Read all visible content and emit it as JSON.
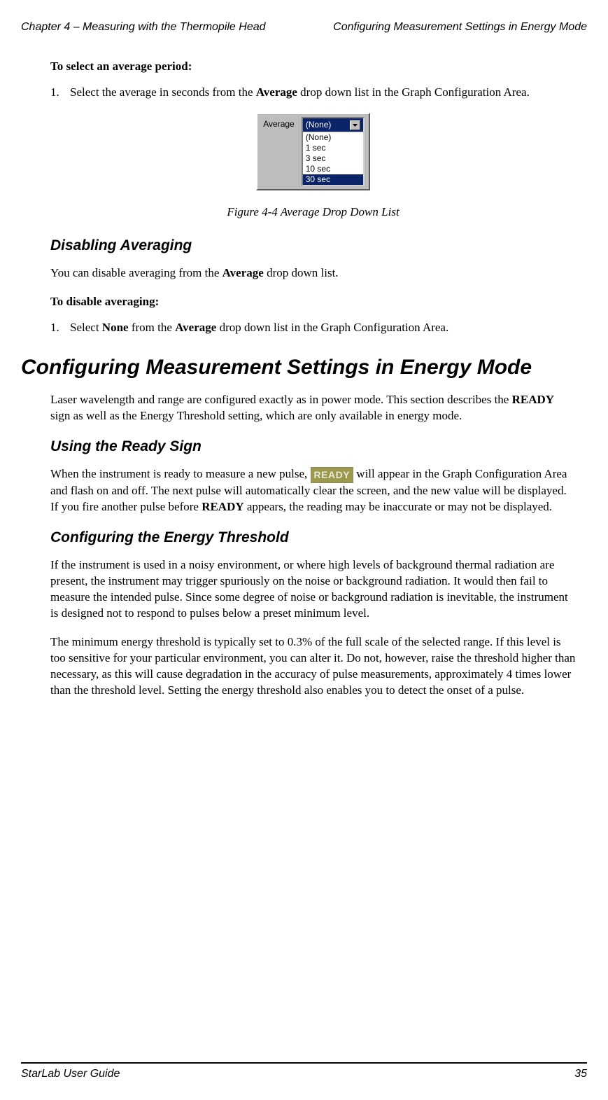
{
  "running_head": {
    "left": "Chapter 4 – Measuring with the Thermopile Head",
    "right": "Configuring Measurement Settings in Energy Mode"
  },
  "intro1": "To select an average period:",
  "step1": {
    "num": "1.",
    "pre": "Select the average in seconds from the ",
    "bold": "Average",
    "post": " drop down list in the Graph Configuration Area."
  },
  "dropdown": {
    "label": "Average",
    "selected": "(None)",
    "items": [
      "(None)",
      "1 sec",
      "3 sec",
      "10 sec",
      "30 sec"
    ],
    "highlight_index": 4
  },
  "fig_caption": "Figure 4-4 Average Drop Down List",
  "sub1": "Disabling Averaging",
  "para1": {
    "pre": "You can disable averaging from the ",
    "bold": "Average",
    "post": " drop down list."
  },
  "intro2": "To disable averaging:",
  "step2": {
    "num": "1.",
    "a": "Select ",
    "b1": "None",
    "b": " from the ",
    "b2": "Average",
    "c": " drop down list in the Graph Configuration Area."
  },
  "big_h": "Configuring Measurement Settings in Energy Mode",
  "para2": {
    "a": "Laser wavelength and range are configured exactly as in power mode. This section describes the ",
    "b": "READY",
    "c": " sign as well as the Energy Threshold setting, which are only available in energy mode."
  },
  "sub2": "Using the Ready Sign",
  "ready_label": "READY",
  "para3": {
    "a": "When the instrument is ready to measure a new pulse, ",
    "b": " will appear in the Graph Configuration Area and flash on and off. The next pulse will automatically clear the screen, and the new value will be displayed. If you fire another pulse before ",
    "c": "READY",
    "d": " appears, the reading may be inaccurate or may not be displayed."
  },
  "sub3": "Configuring the Energy Threshold",
  "para4": "If the instrument is used in a noisy environment, or where high levels of background thermal radiation are present, the instrument may trigger spuriously on the noise or background radiation. It would then fail to measure the intended pulse. Since some degree of noise or background radiation is inevitable, the instrument is designed not to respond to pulses below a preset minimum level.",
  "para5": "The minimum energy threshold is typically set to 0.3% of the full scale of the selected range. If this level is too sensitive for your particular environment, you can alter it. Do not, however, raise the threshold higher than necessary, as this will cause degradation in the accuracy of pulse measurements, approximately 4 times lower than the threshold level. Setting the energy threshold also enables you to detect the onset of a pulse.",
  "footer": {
    "left": "StarLab User Guide",
    "right": "35"
  }
}
